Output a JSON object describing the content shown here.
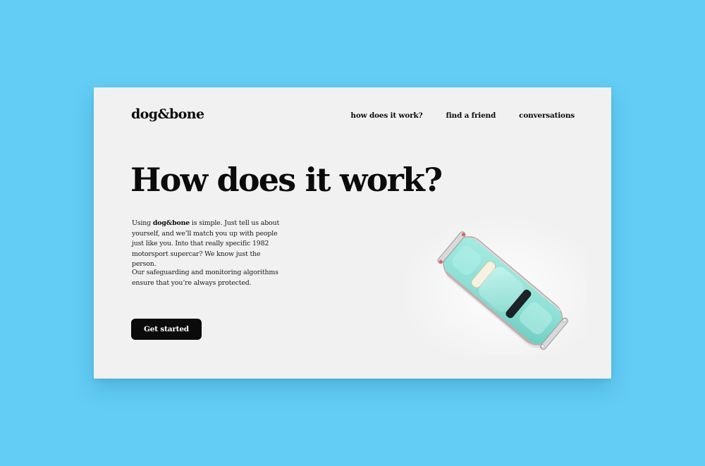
{
  "header": {
    "logo": "dog&bone",
    "nav": [
      {
        "label": "how does it work?"
      },
      {
        "label": "find a friend"
      },
      {
        "label": "conversations"
      }
    ]
  },
  "hero": {
    "title": "How does it work?",
    "para1": {
      "prefix": "Using ",
      "brand": "dog&bone",
      "suffix": " is simple. Just tell us about yourself, and we’ll match you up with people just like you. Into that really specific 1982 motorsport supercar? We know just the person."
    },
    "para2": "Our safeguarding and monitoring algorithms ensure that you’re always protected.",
    "cta_label": "Get started"
  },
  "image": {
    "subject": "toy-car-icon",
    "car_color": "#8ee0d6"
  },
  "colors": {
    "background": "#63cdf5",
    "card": "#f1f1f1",
    "text": "#0b0b0b",
    "button": "#0b0b0b",
    "button_text": "#ffffff"
  }
}
